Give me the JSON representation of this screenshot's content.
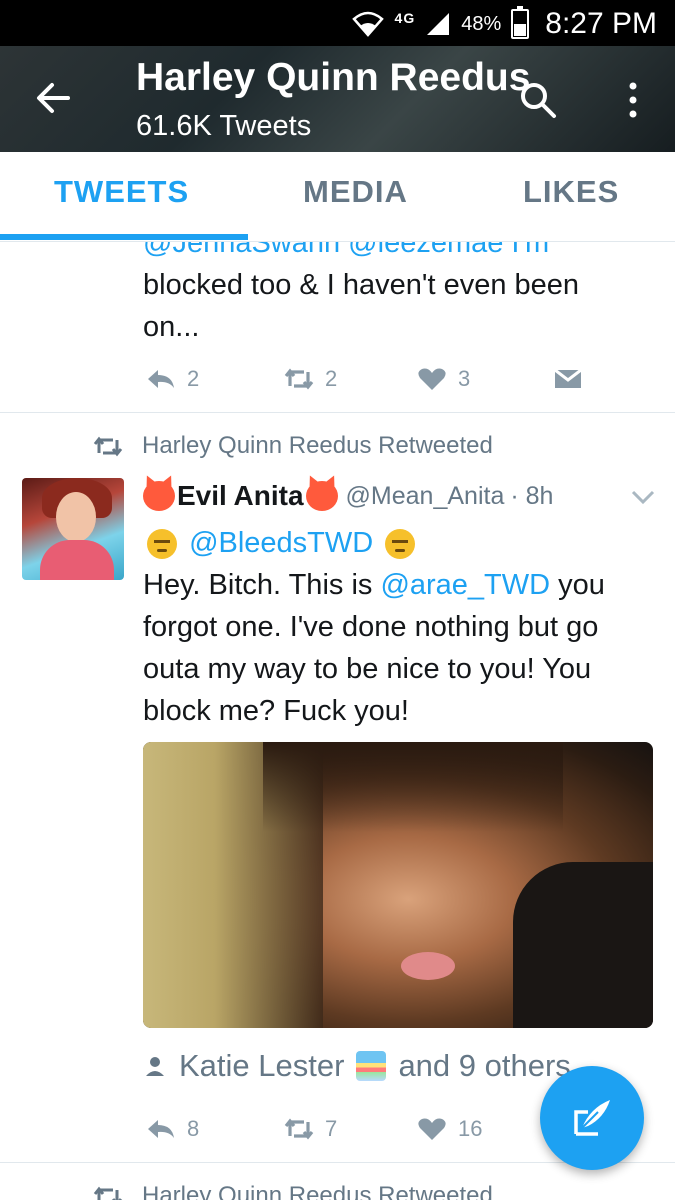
{
  "status_bar": {
    "network": "4G",
    "battery": "48%",
    "time": "8:27 PM"
  },
  "header": {
    "title": "Harley Quinn Reedus",
    "subtitle": "61.6K Tweets"
  },
  "tabs": [
    {
      "label": "TWEETS",
      "active": true
    },
    {
      "label": "MEDIA",
      "active": false
    },
    {
      "label": "LIKES",
      "active": false
    }
  ],
  "tweet1": {
    "mentions_line": "@JennaSwann @leezemae I'm",
    "text": "blocked too & I haven't even been on...",
    "replies": "2",
    "retweets": "2",
    "likes": "3"
  },
  "tweet2": {
    "retweeted_by": "Harley Quinn Reedus Retweeted",
    "name": "Evil Anita",
    "handle": "@Mean_Anita",
    "time": "· 8h",
    "mention_line": "@BleedsTWD",
    "text_part1": "Hey. Bitch. This is ",
    "text_mention": "@arae_TWD",
    "text_part2": " you forgot one. I've done nothing but go outa my way to be nice to you! You block me? Fuck you!",
    "liked_by_name": "Katie Lester",
    "liked_by_rest": "and 9 others",
    "replies": "8",
    "retweets": "7",
    "likes": "16"
  },
  "tweet3": {
    "retweeted_by": "Harley Quinn Reedus Retweeted"
  },
  "colors": {
    "accent": "#1da1f2",
    "muted": "#657786"
  }
}
